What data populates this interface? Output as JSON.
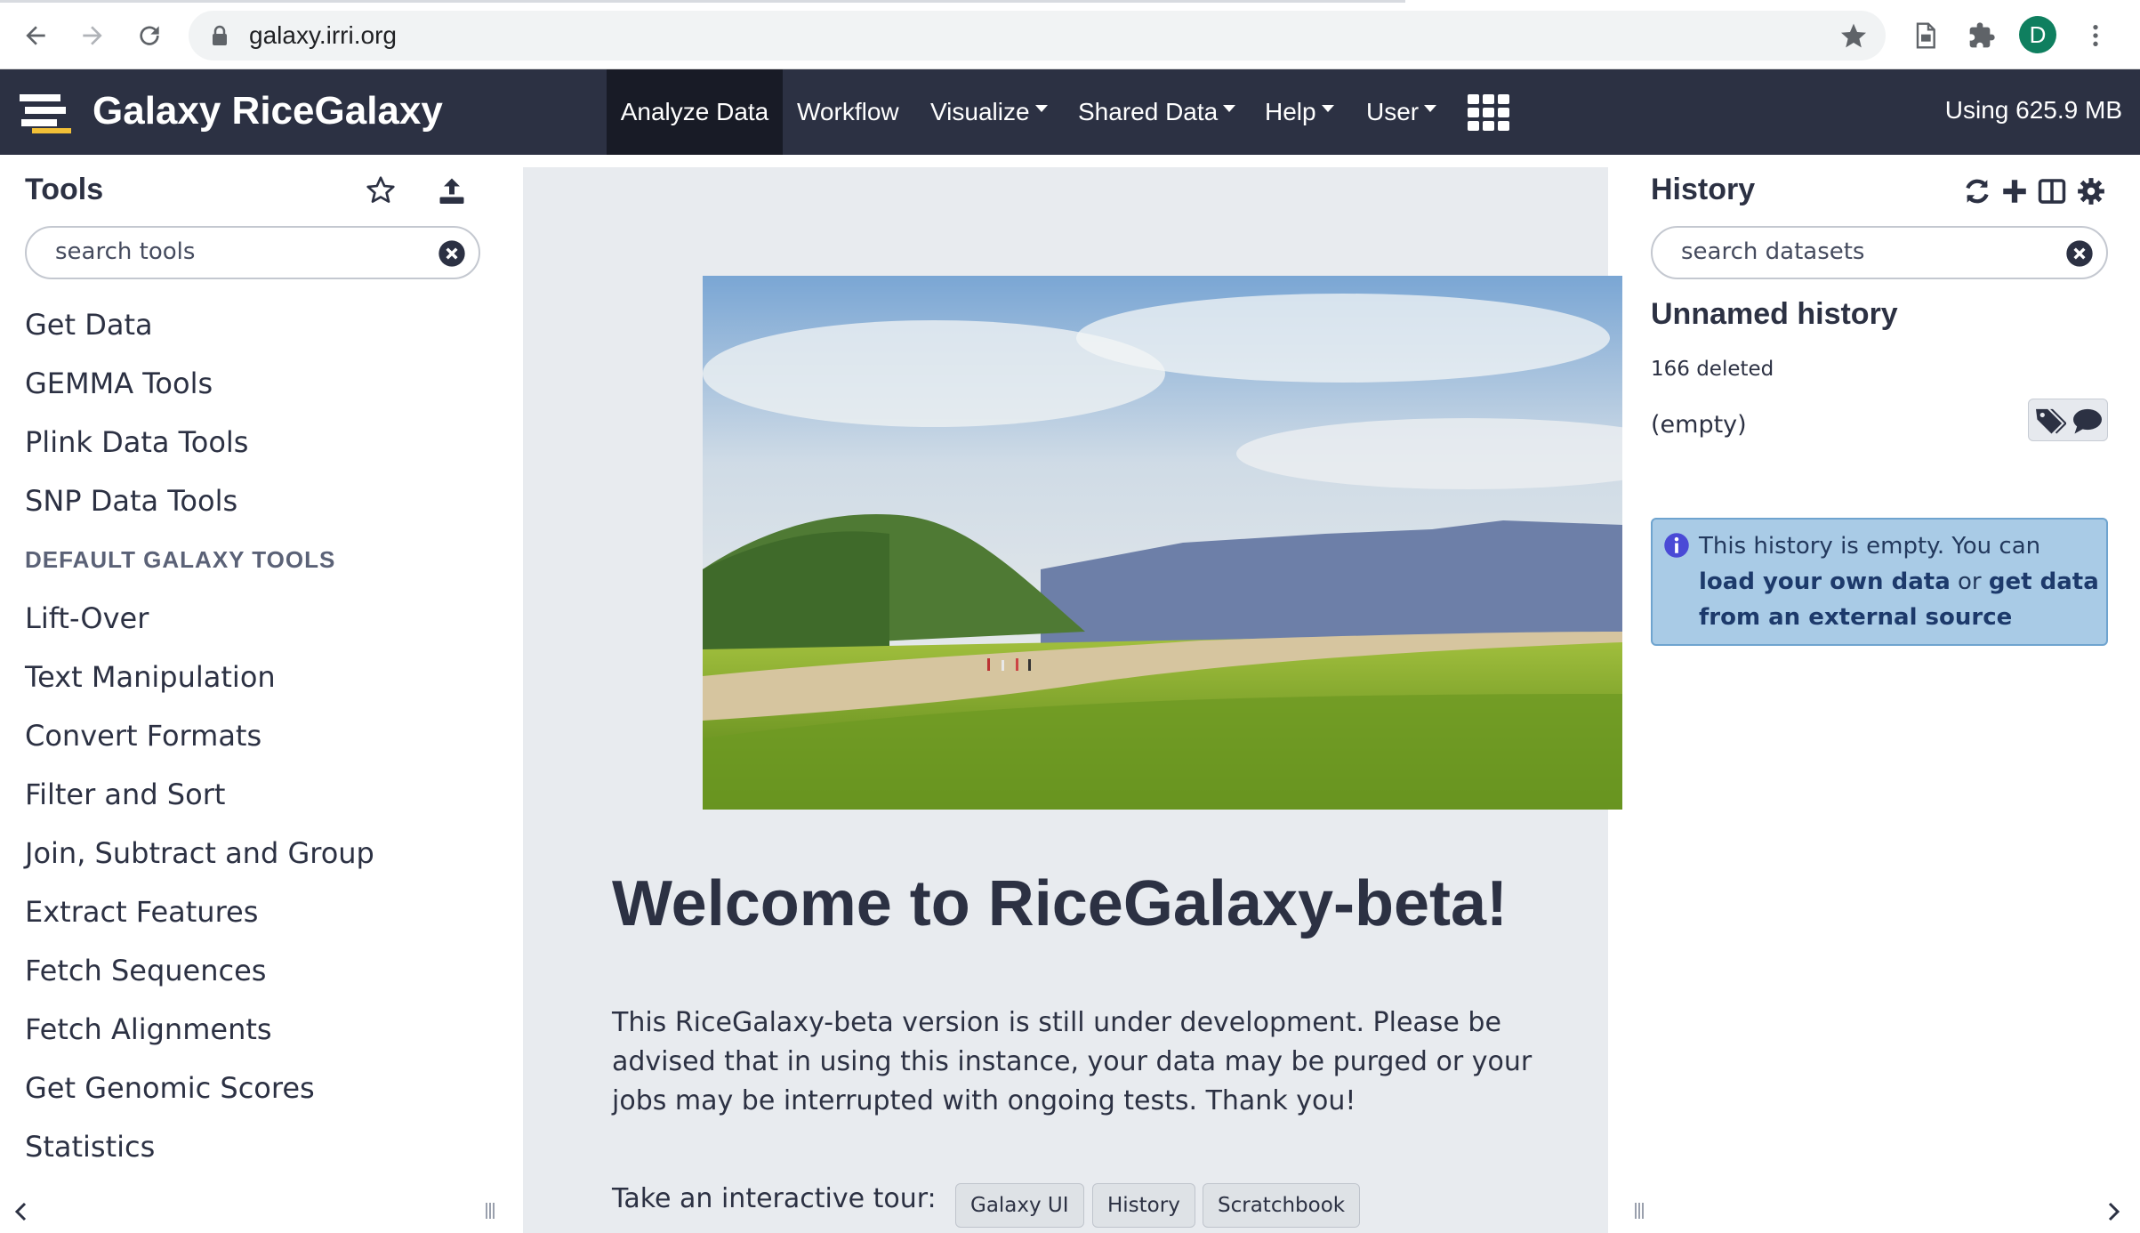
{
  "browser": {
    "url": "galaxy.irri.org",
    "profile_initial": "D",
    "icons": [
      "back-icon",
      "forward-icon",
      "reload-icon",
      "lock-icon",
      "bookmark-star-icon",
      "reading-list-icon",
      "extensions-icon",
      "menu-dots-icon"
    ]
  },
  "masthead": {
    "brand": "Galaxy RiceGalaxy",
    "nav": [
      {
        "label": "Analyze Data",
        "active": true
      },
      {
        "label": "Workflow"
      },
      {
        "label": "Visualize",
        "dropdown": true
      },
      {
        "label": "Shared Data",
        "dropdown": true
      },
      {
        "label": "Help",
        "dropdown": true
      },
      {
        "label": "User",
        "dropdown": true
      }
    ],
    "quota": "Using 625.9 MB"
  },
  "tools": {
    "title": "Tools",
    "search_placeholder": "search tools",
    "items": [
      "Get Data",
      "GEMMA Tools",
      "Plink Data Tools",
      "SNP Data Tools",
      "DEFAULT GALAXY TOOLS",
      "Lift-Over",
      "Text Manipulation",
      "Convert Formats",
      "Filter and Sort",
      "Join, Subtract and Group",
      "Extract Features",
      "Fetch Sequences",
      "Fetch Alignments",
      "Get Genomic Scores",
      "Statistics"
    ]
  },
  "center": {
    "welcome_title": "Welcome to RiceGalaxy-beta!",
    "intro": "This RiceGalaxy-beta version is still under development. Please be advised that in using this instance, your data may be purged or your jobs may be interrupted with ongoing tests. Thank you!",
    "tour_label": "Take an interactive tour:",
    "tour_buttons": [
      "Galaxy UI",
      "History",
      "Scratchbook"
    ]
  },
  "history": {
    "title": "History",
    "search_placeholder": "search datasets",
    "name": "Unnamed history",
    "deleted": "166 deleted",
    "size": "(empty)",
    "empty_msg_prefix": "This history is empty. You can ",
    "link_load": "load your own data",
    "middle": " or ",
    "link_get": "get data from an external source"
  },
  "colors": {
    "masthead": "#2c3143",
    "active_nav": "#181b26",
    "center_bg": "#e8ebef",
    "info_bg": "#a9cbe6",
    "avatar": "#0f7f5f"
  }
}
